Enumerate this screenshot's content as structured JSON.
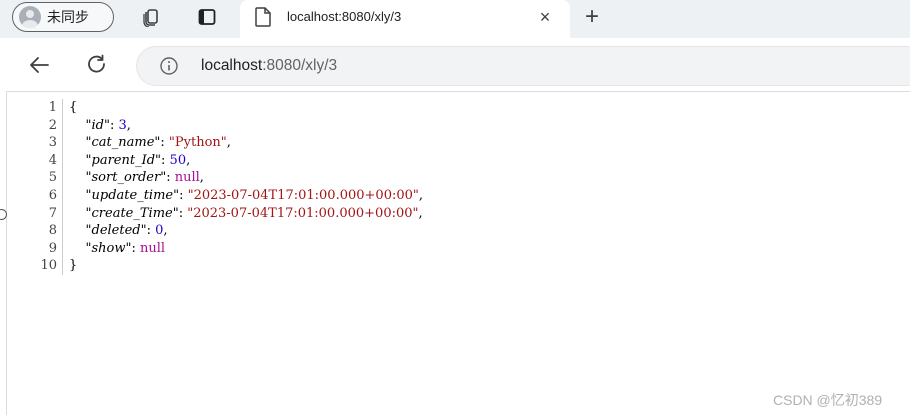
{
  "browser": {
    "profile": {
      "label": "未同步"
    },
    "tab": {
      "title": "localhost:8080/xly/3",
      "close": "×"
    },
    "new_tab": "+",
    "address": {
      "host": "localhost",
      "path": ":8080/xly/3"
    }
  },
  "json_view": {
    "line_numbers": [
      "1",
      "2",
      "3",
      "4",
      "5",
      "6",
      "7",
      "8",
      "9",
      "10"
    ],
    "open_brace": "{",
    "close_brace": "}",
    "entries": [
      {
        "key": "\"id\"",
        "value": "3",
        "type": "number",
        "comma": ","
      },
      {
        "key": "\"cat_name\"",
        "value": "\"Python\"",
        "type": "string",
        "comma": ","
      },
      {
        "key": "\"parent_Id\"",
        "value": "50",
        "type": "number",
        "comma": ","
      },
      {
        "key": "\"sort_order\"",
        "value": "null",
        "type": "null",
        "comma": ","
      },
      {
        "key": "\"update_time\"",
        "value": "\"2023-07-04T17:01:00.000+00:00\"",
        "type": "string",
        "comma": ","
      },
      {
        "key": "\"create_Time\"",
        "value": "\"2023-07-04T17:01:00.000+00:00\"",
        "type": "string",
        "comma": ","
      },
      {
        "key": "\"deleted\"",
        "value": "0",
        "type": "number",
        "comma": ","
      },
      {
        "key": "\"show\"",
        "value": "null",
        "type": "null",
        "comma": ""
      }
    ]
  },
  "watermark": "CSDN @忆初389",
  "colors": {
    "string": "#a31515",
    "number": "#1c00cf",
    "null": "#aa0d91"
  }
}
